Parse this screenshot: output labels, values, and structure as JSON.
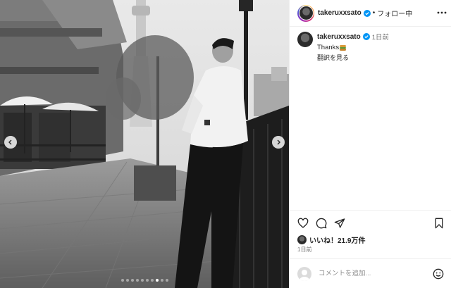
{
  "header": {
    "username": "takeruxxsato",
    "separator": "•",
    "follow_label": "フォロー中"
  },
  "post": {
    "username": "takeruxxsato",
    "time": "1日前",
    "caption": "Thanks",
    "translate_label": "翻訳を見る"
  },
  "actions": {
    "likes_label": "いいね！21.9万件",
    "timestamp": "1日前"
  },
  "composer": {
    "placeholder": "コメントを追加..."
  },
  "carousel": {
    "total": 10,
    "active_index": 7
  },
  "icons": [
    "chevron-left-icon",
    "chevron-right-icon",
    "verified-badge-icon",
    "more-icon",
    "heart-icon",
    "comment-icon",
    "share-icon",
    "bookmark-icon",
    "emoji-icon"
  ],
  "colors": {
    "verified": "#0095f6",
    "border": "#efefef",
    "secondary_text": "#737373"
  }
}
